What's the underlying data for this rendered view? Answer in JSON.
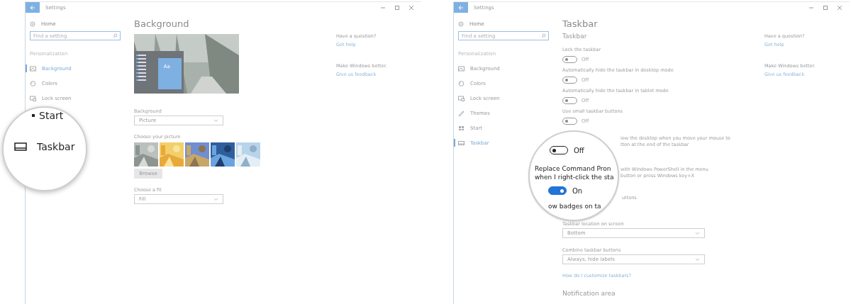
{
  "left_window": {
    "title": "Settings",
    "sidebar": {
      "home": "Home",
      "search_placeholder": "Find a setting",
      "section": "Personalization",
      "items": [
        {
          "label": "Background",
          "selected": true
        },
        {
          "label": "Colors",
          "selected": false
        },
        {
          "label": "Lock screen",
          "selected": false
        }
      ]
    },
    "page": {
      "title": "Background",
      "preview_tile": "Aa",
      "background_label": "Background",
      "background_value": "Picture",
      "choose_picture_label": "Choose your picture",
      "browse_button": "Browse",
      "fit_label": "Choose a fit",
      "fit_value": "Fill"
    },
    "help": {
      "question": "Have a question?",
      "get_help": "Get help",
      "better": "Make Windows better.",
      "feedback": "Give us feedback"
    },
    "magnifier": {
      "items": [
        {
          "label": "Start"
        },
        {
          "label": "Taskbar"
        }
      ]
    }
  },
  "right_window": {
    "title": "Settings",
    "sidebar": {
      "home": "Home",
      "search_placeholder": "Find a setting",
      "section": "Personalization",
      "items": [
        {
          "label": "Background",
          "selected": false
        },
        {
          "label": "Colors",
          "selected": false
        },
        {
          "label": "Lock screen",
          "selected": false
        },
        {
          "label": "Themes",
          "selected": false
        },
        {
          "label": "Start",
          "selected": false
        },
        {
          "label": "Taskbar",
          "selected": true
        }
      ]
    },
    "page": {
      "title": "Taskbar",
      "section": "Taskbar",
      "toggles": [
        {
          "label": "Lock the taskbar",
          "on": false,
          "state_text": "Off"
        },
        {
          "label": "Automatically hide the taskbar in desktop mode",
          "on": false,
          "state_text": "Off"
        },
        {
          "label": "Automatically hide the taskbar in tablet mode",
          "on": false,
          "state_text": "Off"
        },
        {
          "label": "Use small taskbar buttons",
          "on": false,
          "state_text": "Off"
        }
      ],
      "peek_fragments": [
        "iew the desktop when you move your mouse to",
        "tton at the end of the taskbar"
      ],
      "powershell_fragments": [
        "with Windows PowerShell in the menu",
        "button or press Windows key+X"
      ],
      "badges_fragment": "uttons",
      "location_label": "Taskbar location on screen",
      "location_value": "Bottom",
      "combine_label": "Combine taskbar buttons",
      "combine_value": "Always, hide labels",
      "customize_link": "How do I customize taskbars?",
      "notification_heading": "Notification area"
    },
    "help": {
      "question": "Have a question?",
      "get_help": "Get help",
      "better": "Make Windows better.",
      "feedback": "Give us feedback"
    },
    "magnifier": {
      "toggles": [
        {
          "on": false,
          "state_text": "Off"
        },
        {
          "on": true,
          "state_text": "On"
        }
      ],
      "lines": [
        "Replace Command Pron",
        "when I right-click the sta"
      ],
      "cut_label": "ow badges on ta"
    }
  }
}
